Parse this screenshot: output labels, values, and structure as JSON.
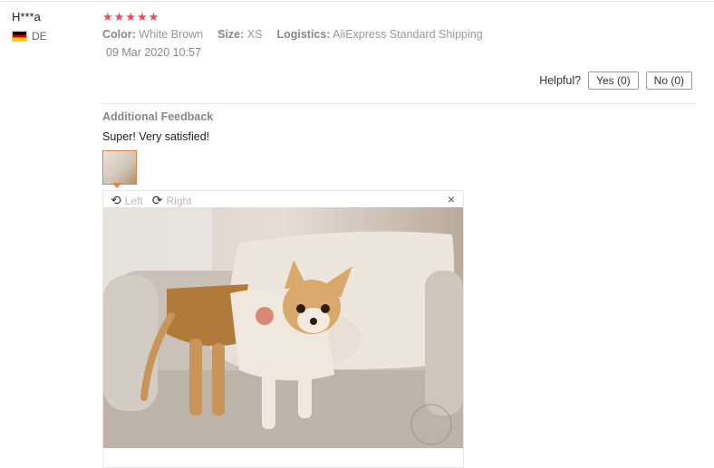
{
  "review": {
    "user_name": "H***a",
    "country": "DE",
    "rating": 5,
    "attributes": {
      "color_label": "Color:",
      "color_value": "White Brown",
      "size_label": "Size:",
      "size_value": "XS",
      "logistics_label": "Logistics:",
      "logistics_value": "AliExpress Standard Shipping"
    },
    "date": "09 Mar 2020 10:57"
  },
  "helpful": {
    "label": "Helpful?",
    "yes": "Yes (0)",
    "no": "No (0)"
  },
  "additional": {
    "title": "Additional Feedback",
    "text": "Super! Very satisfied!"
  },
  "viewer": {
    "rotate_left": "Left",
    "rotate_right": "Right",
    "close": "×"
  },
  "icons": {
    "star": "star-icon",
    "rotate_left": "rotate-left-icon",
    "rotate_right": "rotate-right-icon",
    "close": "close-icon"
  },
  "colors": {
    "star": "#f04a5a",
    "thumb_border": "#e5843f"
  }
}
